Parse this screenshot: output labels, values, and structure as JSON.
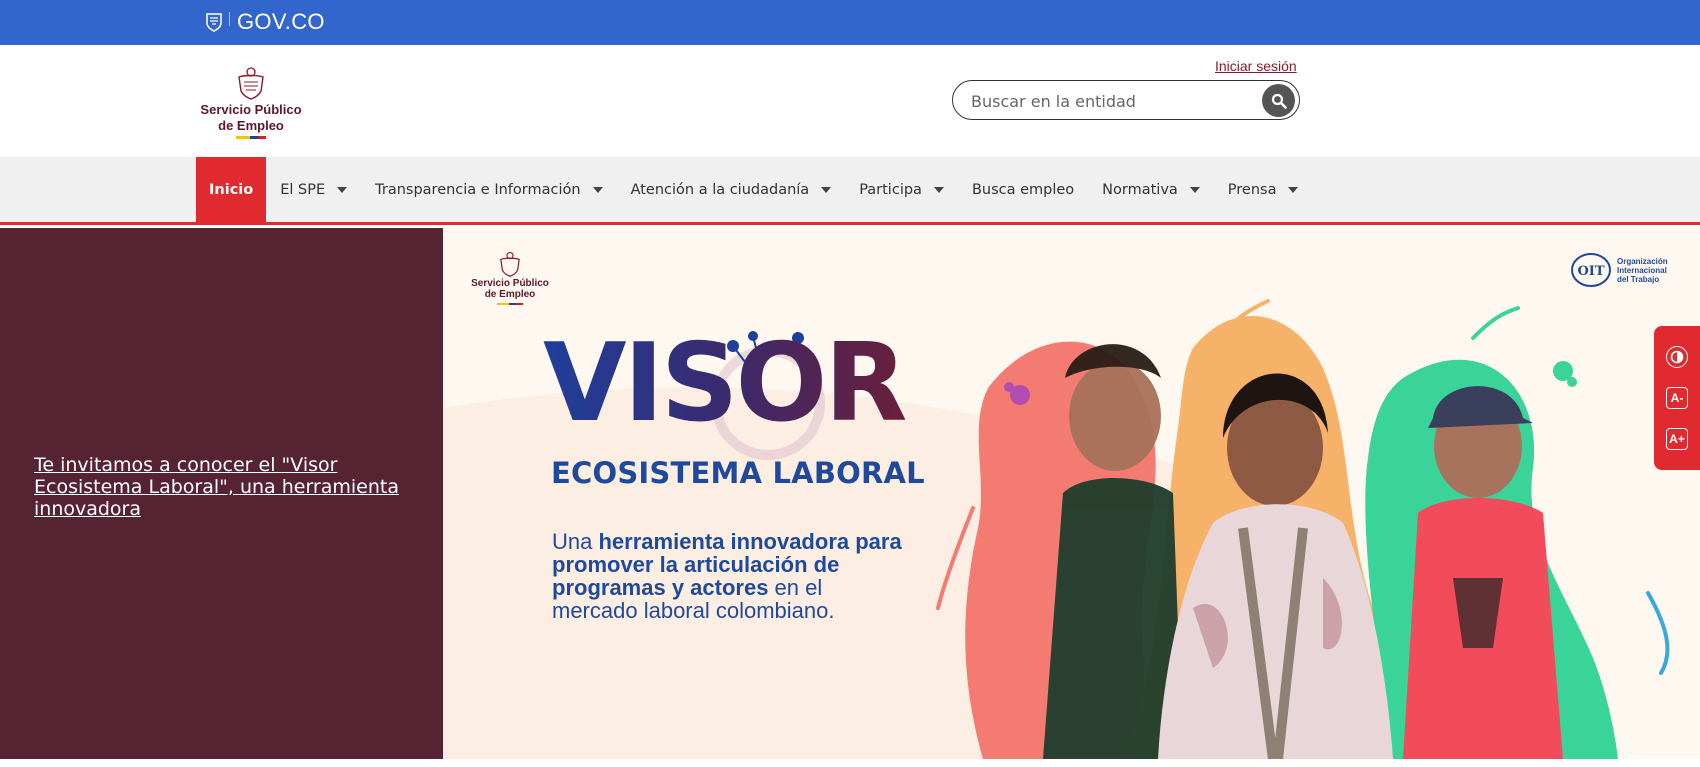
{
  "govbar": {
    "brand": "GOV.CO",
    "color": "#3366cc"
  },
  "header": {
    "logo_line1": "Servicio Público",
    "logo_line2": "de Empleo",
    "login_link": "Iniciar sesión",
    "search_placeholder": "Buscar en la entidad",
    "search_icon": "search-icon"
  },
  "nav": {
    "items": [
      {
        "label": "Inicio",
        "active": true,
        "dropdown": false
      },
      {
        "label": "El SPE",
        "dropdown": true
      },
      {
        "label": "Transparencia e Información",
        "dropdown": true
      },
      {
        "label": "Atención a la ciudadanía",
        "dropdown": true
      },
      {
        "label": "Participa",
        "dropdown": true
      },
      {
        "label": "Busca empleo",
        "dropdown": false
      },
      {
        "label": "Normativa",
        "dropdown": true
      },
      {
        "label": "Prensa",
        "dropdown": true
      }
    ],
    "accent": "#e02a2f"
  },
  "carousel": {
    "caption_link": "Te invitamos a conocer el \"Visor Ecosistema Laboral\", una herramienta innovadora",
    "panel_color": "#562332",
    "hero": {
      "logo_line1": "Servicio Público",
      "logo_line2": "de Empleo",
      "oit_line1": "Organización",
      "oit_line2": "Internacional",
      "oit_line3": "del Trabajo",
      "oit_logo": "OIT",
      "title": "VISOR",
      "subtitle": "ECOSISTEMA LABORAL",
      "tagline_1": "Una ",
      "tagline_b1": "herramienta innovadora para promover la articulación de programas y actores",
      "tagline_2": " en el mercado laboral colombiano."
    }
  },
  "accessibility": {
    "buttons": [
      "contrast-icon",
      "decrease-font-icon",
      "increase-font-icon"
    ],
    "decrease_label": "A-",
    "increase_label": "A+"
  }
}
